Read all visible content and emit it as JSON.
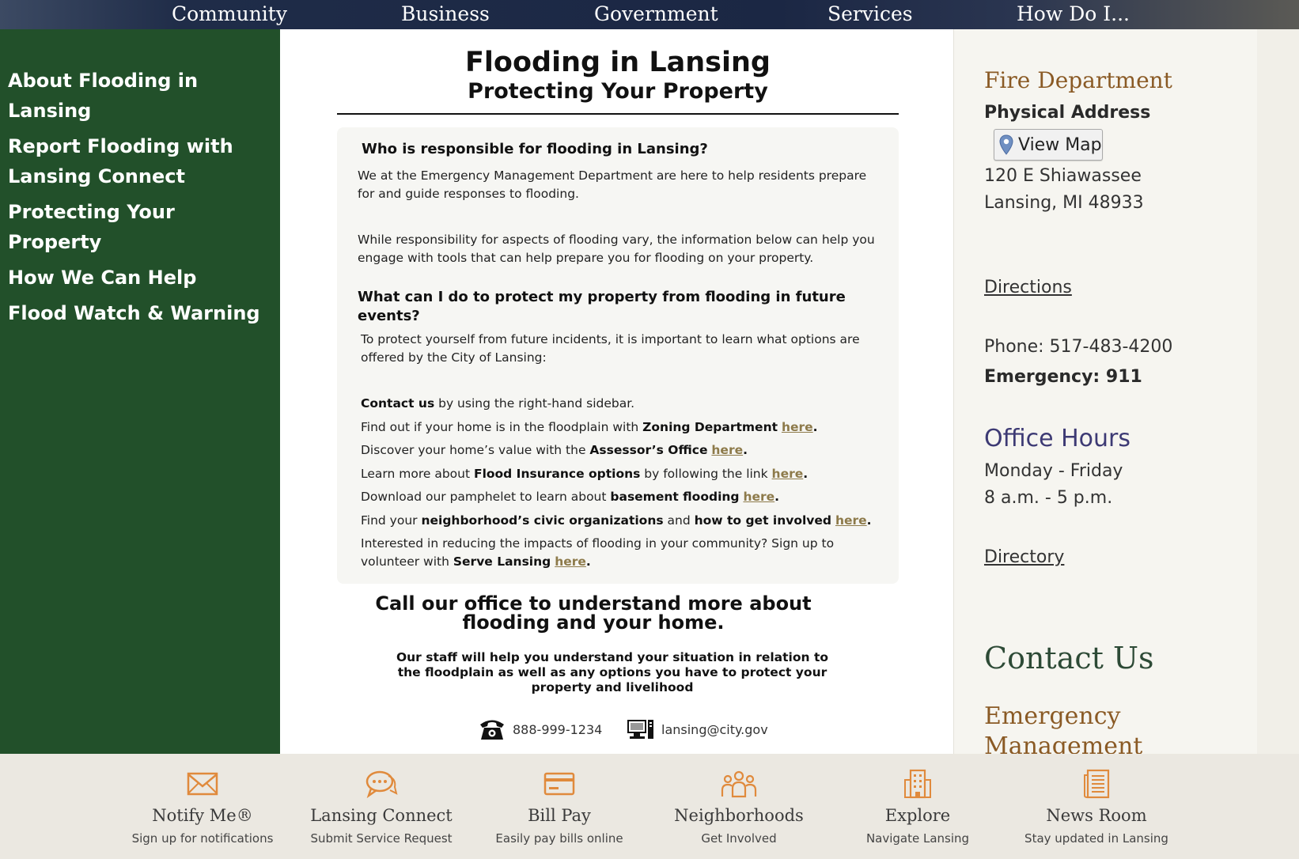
{
  "topnav": {
    "items": [
      "Community",
      "Business",
      "Government",
      "Services",
      "How Do I..."
    ]
  },
  "sidebar": {
    "items": [
      "About Flooding in Lansing",
      "Report Flooding with Lansing Connect",
      "Protecting Your Property",
      "How We Can Help",
      "Flood Watch & Warning"
    ]
  },
  "main": {
    "title": "Flooding in Lansing",
    "subtitle": "Protecting Your Property",
    "q1": "Who is responsible for flooding in Lansing?",
    "p1": "We at the Emergency Management Department are here to help residents prepare for and guide responses to flooding.",
    "p2": "While responsibility for aspects of flooding vary, the information below can help you engage with tools that can help prepare you for flooding on your property.",
    "q2": "What can I do to protect my property from flooding in future events?",
    "p3": "To protect yourself from future incidents, it is important to learn what options are offered by the City of Lansing:",
    "link_text": "here",
    "list": {
      "contact_b": "Contact us",
      "contact_t": " by using the right-hand sidebar.",
      "zoning_a": "Find out if your home is in the floodplain with ",
      "zoning_b": "Zoning Department",
      "assessor_a": "Discover your home’s value with the ",
      "assessor_b": "Assessor’s Office",
      "insurance_a": "Learn more about ",
      "insurance_b": "Flood Insurance options",
      "insurance_c": " by following the link ",
      "basement_a": "Download our pamphelet to learn about ",
      "basement_b": "basement flooding",
      "civic_a": "Find your ",
      "civic_b": "neighborhood’s civic organizations",
      "civic_c": " and ",
      "civic_d": "how to get involved",
      "volunteer_a": "Interested in reducing the impacts of flooding in your community? Sign up to volunteer with ",
      "volunteer_b": "Serve Lansing"
    },
    "cta_title": "Call our office to understand more about flooding and your home.",
    "cta_sub": "Our staff will help you understand your situation in relation to the floodplain as well as any options you have to protect your property and livelihood",
    "phone": "888-999-1234",
    "email": "lansing@city.gov"
  },
  "right": {
    "dept": "Fire Department",
    "address_label": "Physical Address",
    "view_map": "View Map",
    "address1": "120 E Shiawassee",
    "address2": "Lansing, MI 48933",
    "directions": "Directions",
    "phone": "Phone: 517-483-4200",
    "emergency": "Emergency: 911",
    "office_hours": "Office Hours",
    "days": "Monday - Friday",
    "hours": "8 a.m. - 5 p.m.",
    "directory": "Directory",
    "contact_us": "Contact Us",
    "division": "Emergency Management Division"
  },
  "footer": {
    "items": [
      {
        "title": "Notify Me®",
        "sub": "Sign up for notifications",
        "icon": "envelope-icon"
      },
      {
        "title": "Lansing Connect",
        "sub": "Submit Service Request",
        "icon": "chat-icon"
      },
      {
        "title": "Bill Pay",
        "sub": "Easily pay bills online",
        "icon": "card-icon"
      },
      {
        "title": "Neighborhoods",
        "sub": "Get Involved",
        "icon": "people-icon"
      },
      {
        "title": "Explore",
        "sub": "Navigate Lansing",
        "icon": "building-icon"
      },
      {
        "title": "News Room",
        "sub": "Stay updated in Lansing",
        "icon": "newspaper-icon"
      }
    ]
  },
  "colors": {
    "nav_bg": "#1b2744",
    "sidebar_bg": "#22502a",
    "link_gold": "#8d7a4a",
    "heading_brown": "#8a5a25",
    "office_purple": "#3d3a74",
    "footer_bg": "#ebe8e1",
    "icon_orange": "#e08a3c"
  }
}
